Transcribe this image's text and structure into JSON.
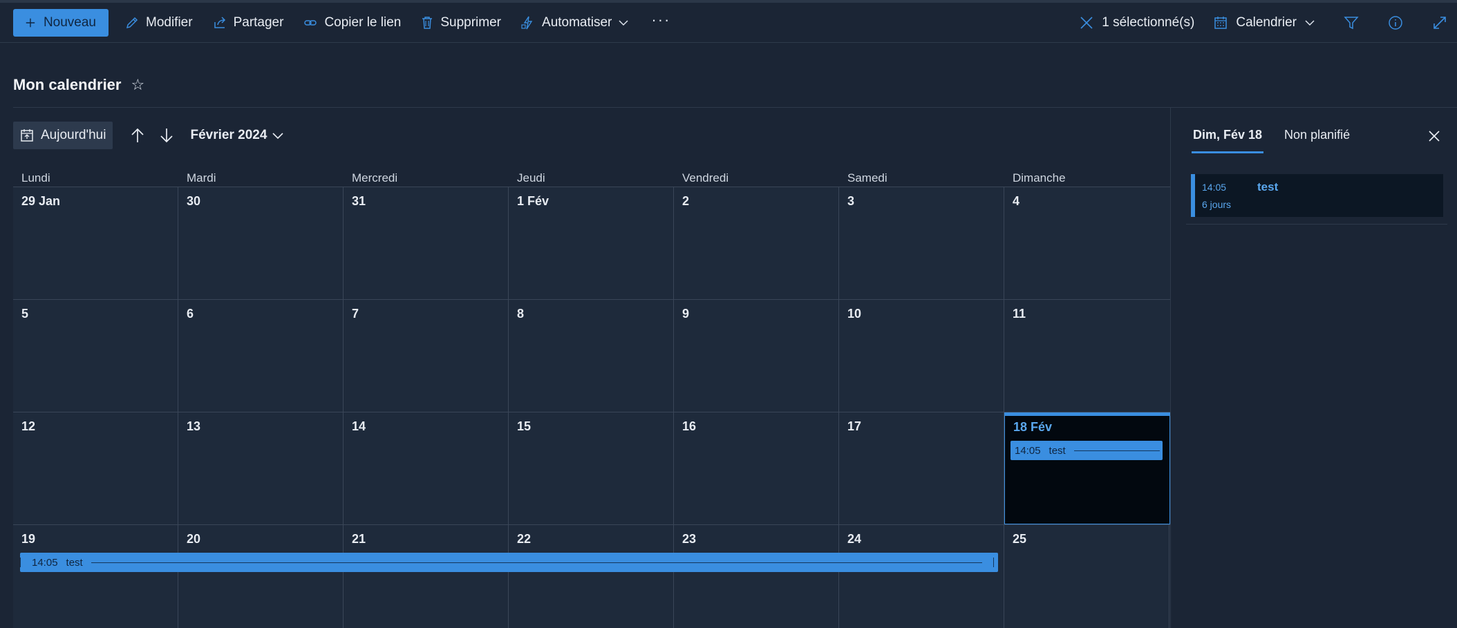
{
  "toolbar": {
    "new_label": "Nouveau",
    "edit_label": "Modifier",
    "share_label": "Partager",
    "copy_link_label": "Copier le lien",
    "delete_label": "Supprimer",
    "automate_label": "Automatiser",
    "more_label": "···",
    "selected_label": "1 sélectionné(s)",
    "view_label": "Calendrier"
  },
  "page": {
    "title": "Mon calendrier",
    "favorite_glyph": "☆"
  },
  "calendar_nav": {
    "today_label": "Aujourd'hui",
    "month_label": "Février 2024"
  },
  "weekdays": [
    "Lundi",
    "Mardi",
    "Mercredi",
    "Jeudi",
    "Vendredi",
    "Samedi",
    "Dimanche"
  ],
  "weeks": [
    [
      "29 Jan",
      "30",
      "31",
      "1 Fév",
      "2",
      "3",
      "4"
    ],
    [
      "5",
      "6",
      "7",
      "8",
      "9",
      "10",
      "11"
    ],
    [
      "12",
      "13",
      "14",
      "15",
      "16",
      "17",
      "18 Fév"
    ],
    [
      "19",
      "20",
      "21",
      "22",
      "23",
      "24",
      "25"
    ]
  ],
  "selected_day": "18 Fév",
  "events": [
    {
      "time": "14:05",
      "title": "test"
    },
    {
      "time": "14:05",
      "title": "test"
    }
  ],
  "side_panel": {
    "tab_day": "Dim, Fév 18",
    "tab_unscheduled": "Non planifié",
    "item": {
      "time": "14:05",
      "title": "test",
      "duration": "6 jours"
    }
  },
  "colors": {
    "accent": "#3a8ee0",
    "background": "#1b2535",
    "cell": "#1e2a3b",
    "selected_cell": "#02080f"
  }
}
